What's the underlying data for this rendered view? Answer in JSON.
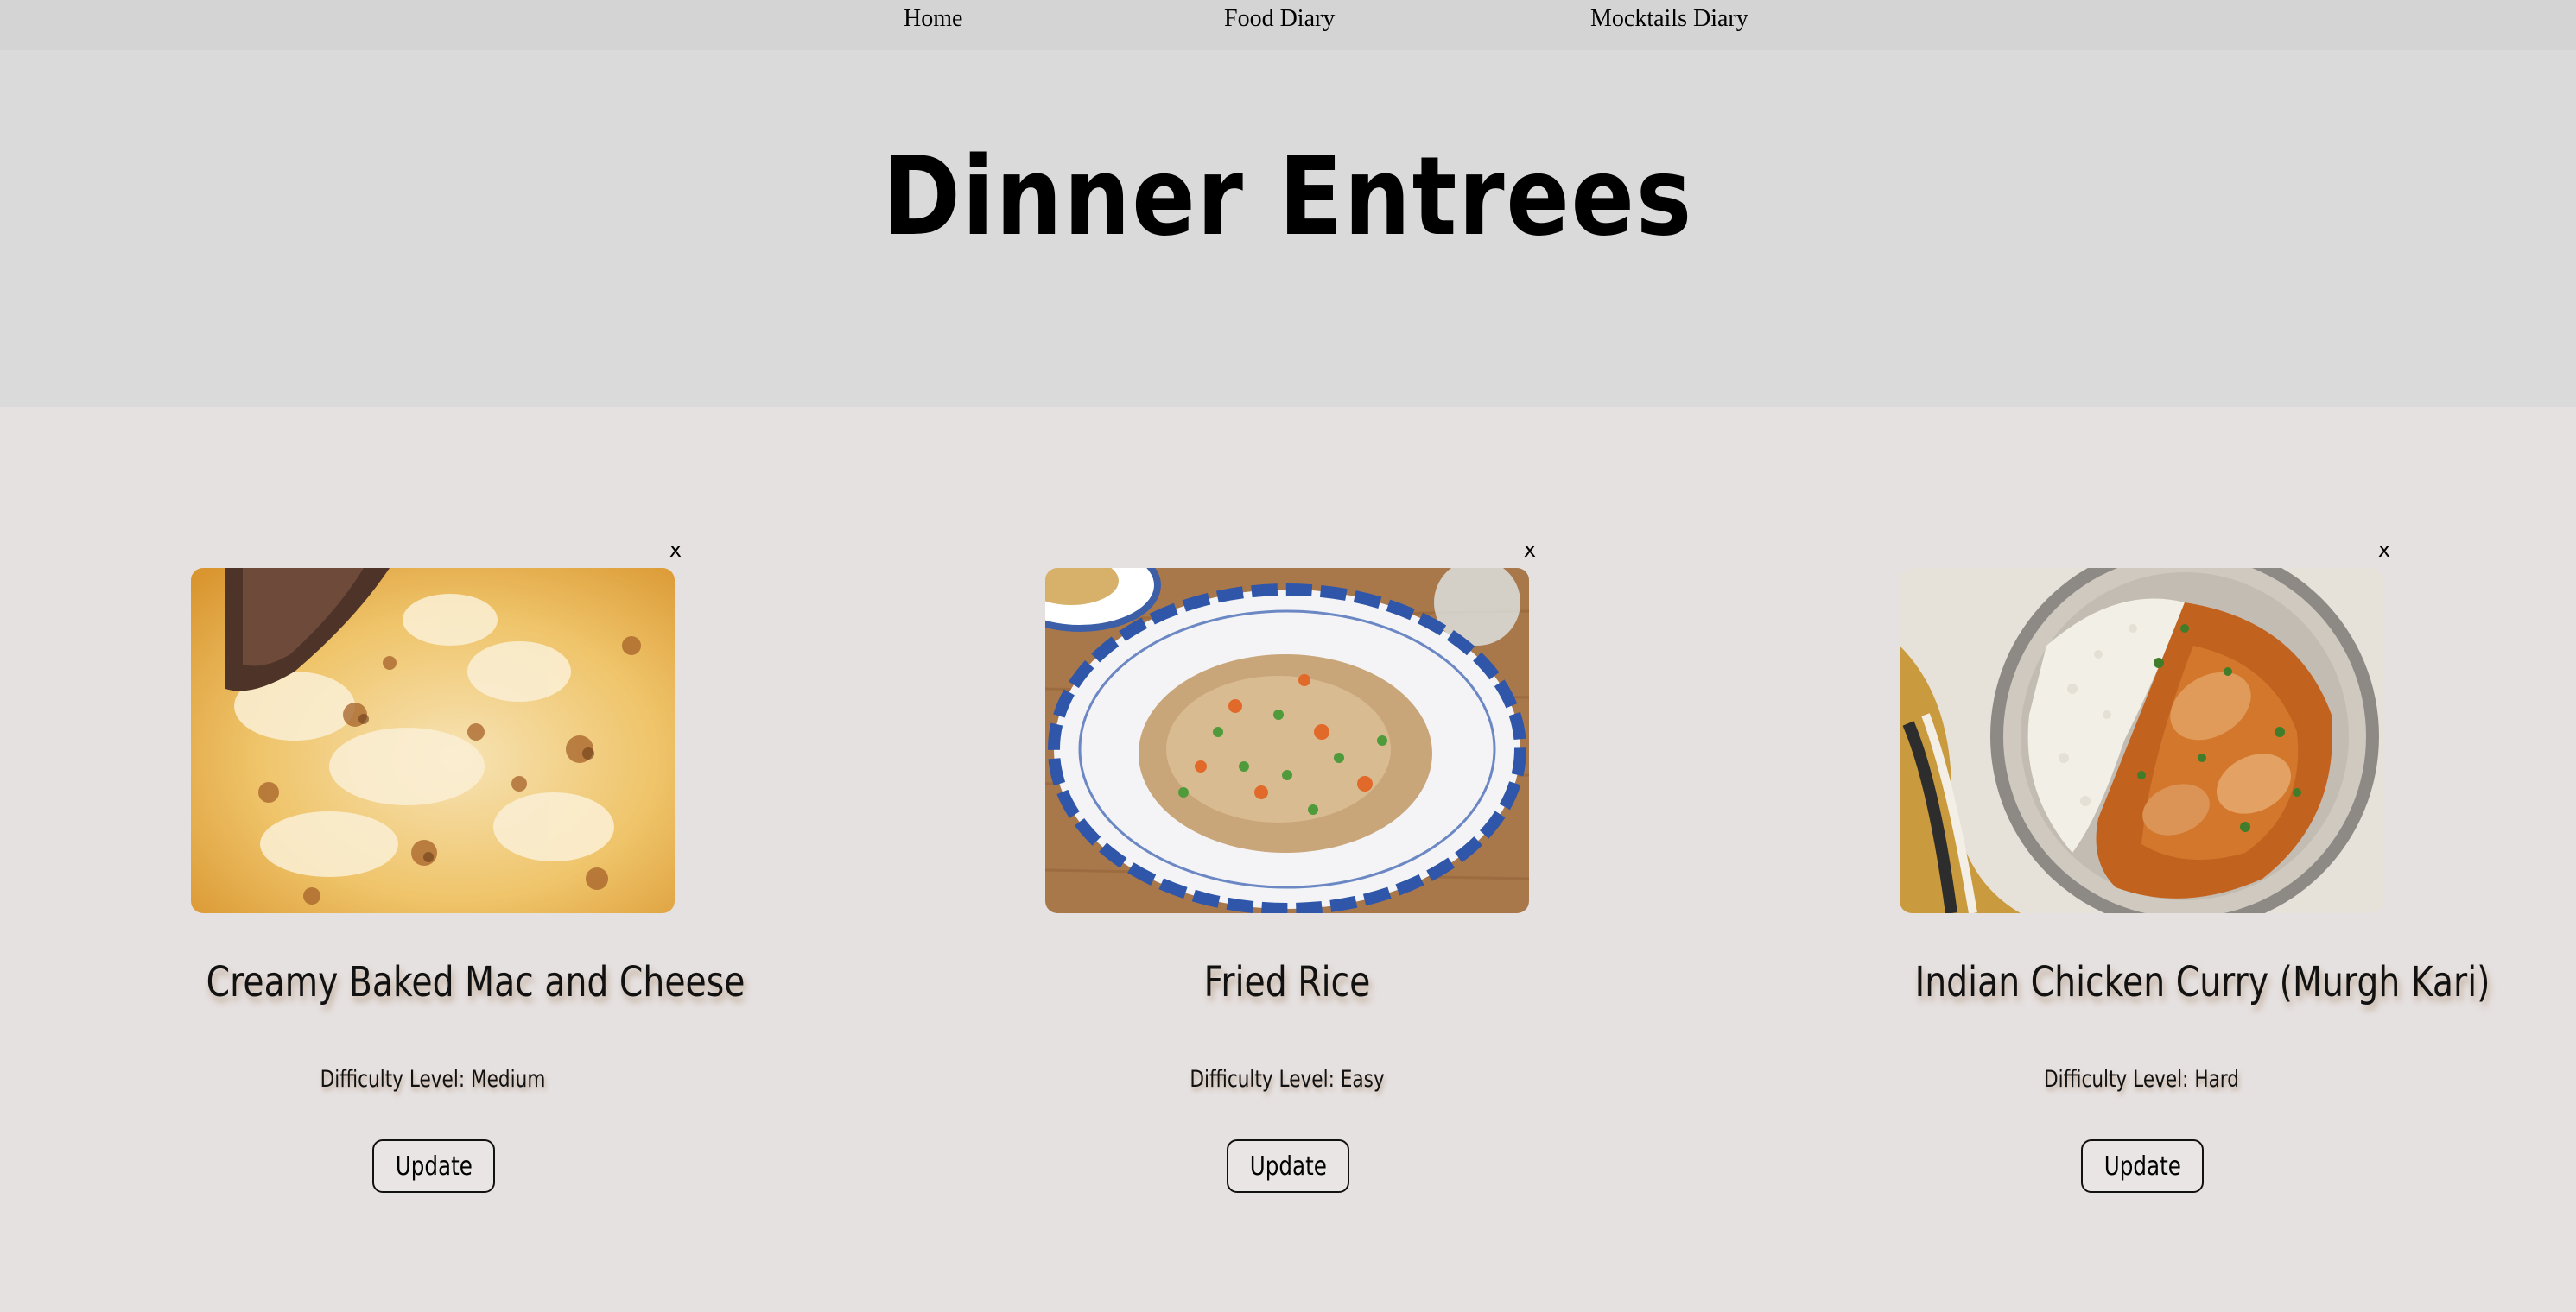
{
  "nav": {
    "items": [
      {
        "label": "Home"
      },
      {
        "label": "Food Diary"
      },
      {
        "label": "Mocktails Diary"
      }
    ]
  },
  "header": {
    "title": "Dinner Entrees"
  },
  "cards": [
    {
      "close_label": "x",
      "image": "mac-and-cheese-photo",
      "title": "Creamy Baked Mac and Cheese",
      "difficulty": "Difficulty Level: Medium",
      "button_label": "Update"
    },
    {
      "close_label": "x",
      "image": "fried-rice-photo",
      "title": "Fried Rice",
      "difficulty": "Difficulty Level: Easy",
      "button_label": "Update"
    },
    {
      "close_label": "x",
      "image": "chicken-curry-photo",
      "title": "Indian Chicken Curry (Murgh Kari)",
      "difficulty": "Difficulty Level: Hard",
      "button_label": "Update"
    }
  ],
  "colors": {
    "nav_background": "#d4d4d4",
    "hero_background": "#dadada",
    "page_background": "#e6e1e1"
  }
}
